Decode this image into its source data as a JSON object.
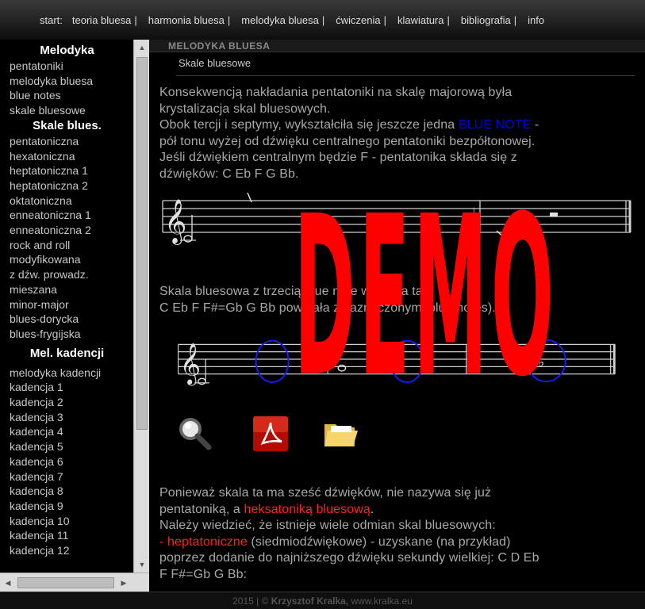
{
  "nav": {
    "start_label": "start:",
    "links": [
      "teoria bluesa",
      "harmonia bluesa",
      "melodyka bluesa",
      "ćwiczenia",
      "klawiatura",
      "bibliografia",
      "info"
    ],
    "separator": "|"
  },
  "sidebar": {
    "sections": [
      {
        "heading": "Melodyka",
        "items": [
          "pentatoniki",
          "melodyka bluesa",
          "blue notes",
          "skale bluesowe"
        ]
      },
      {
        "heading": "Skale blues.",
        "items": [
          "pentatoniczna",
          "hexatoniczna",
          "heptatoniczna 1",
          "heptatoniczna 2",
          "oktatoniczna",
          "enneatoniczna 1",
          "enneatoniczna 2",
          "rock and roll",
          "modyfikowana",
          "z dźw. prowadz.",
          "mieszana",
          "minor-major",
          "blues-dorycka",
          "blues-frygijska"
        ]
      },
      {
        "heading": "Mel. kadencji",
        "items": [
          "melodyka kadencji",
          "kadencja 1",
          "kadencja 2",
          "kadencja 3",
          "kadencja 4",
          "kadencja 5",
          "kadencja 6",
          "kadencja 7",
          "kadencja 8",
          "kadencja 9",
          "kadencja 10",
          "kadencja 11",
          "kadencja 12"
        ]
      }
    ]
  },
  "main": {
    "section_title": "MELODYKA BLUESA",
    "subtitle": "Skale bluesowe",
    "p1": {
      "line1": "Konsekwencją nakładania pentatoniki na skalę majorową była",
      "line2": "krystalizacja skal bluesowych.",
      "line3_pre": "Obok tercji i septymy, wykształciła się jeszcze jedna ",
      "line3_blue": "BLUE NOTE",
      "line3_post": " -",
      "line4": "pół tonu wyżej od dźwięku centralnego pentatoniki bezpółtonowej.",
      "line5": "Jeśli dźwiękiem centralnym będzie F - pentatonika składa się z",
      "line6": "dźwięków: C Eb F G Bb."
    },
    "p2": {
      "line1": "Skala bluesowa z trzecią blue note wygląda tak:",
      "line2": "C Eb F F#=Gb G Bb powstała z zaznaczonymi blue notes)."
    },
    "p3": {
      "line1": "Ponieważ skala ta ma sześć dźwięków, nie nazywa się już",
      "line2_pre": "pentatoniką, a ",
      "line2_red": "heksatoniką bluesową",
      "line2_post": ".",
      "line3": "Należy wiedzieć, że istnieje wiele odmian skal bluesowych:",
      "line4_red": "- heptatoniczne",
      "line4_post": " (siedmiodźwiękowe) - uzyskane (na przykład)",
      "line5": "poprzez dodanie do najniższego dźwięku sekundy wielkiej: C D Eb",
      "line6": "F F#=Gb G Bb:"
    },
    "watermark": "DEMO",
    "icons": [
      "magnifier-icon",
      "pdf-icon",
      "folder-icon"
    ]
  },
  "footer": {
    "year": "2015",
    "sep": " | © ",
    "author": "Krzysztof Kralka,",
    "site": " www.kralka.eu"
  },
  "colors": {
    "blue_note": "#0000e6",
    "highlight_red": "#ff2020",
    "watermark": "#ff0000"
  }
}
